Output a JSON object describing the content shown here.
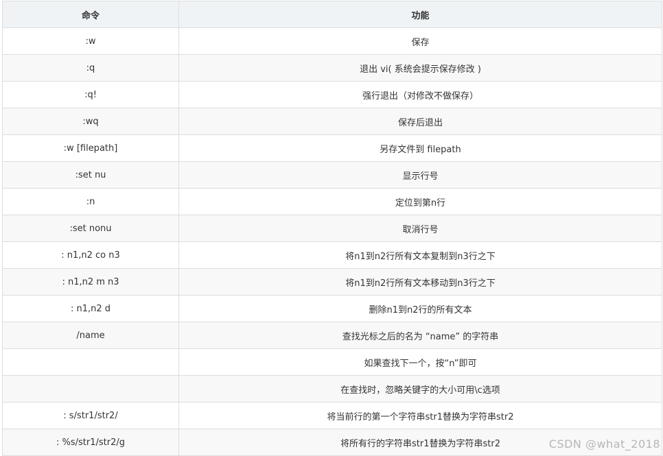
{
  "table": {
    "headers": [
      "命令",
      "功能"
    ],
    "rows": [
      {
        "command": ":w",
        "function": "保存"
      },
      {
        "command": ":q",
        "function": "退出 vi( 系统会提示保存修改 )"
      },
      {
        "command": ":q!",
        "function": "强行退出（对修改不做保存）"
      },
      {
        "command": ":wq",
        "function": "保存后退出"
      },
      {
        "command": ":w [filepath]",
        "function": "另存文件到 filepath"
      },
      {
        "command": ":set nu",
        "function": "显示行号"
      },
      {
        "command": ":n",
        "function": "定位到第n行"
      },
      {
        "command": ":set nonu",
        "function": "取消行号"
      },
      {
        "command": ": n1,n2 co n3",
        "function": "将n1到n2行所有文本复制到n3行之下"
      },
      {
        "command": ": n1,n2 m n3",
        "function": "将n1到n2行所有文本移动到n3行之下"
      },
      {
        "command": ": n1,n2 d",
        "function": "删除n1到n2行的所有文本"
      },
      {
        "command": "/name",
        "function": "查找光标之后的名为 “name” 的字符串"
      },
      {
        "command": "",
        "function": "如果查找下一个，按“n”即可"
      },
      {
        "command": "",
        "function": "在查找时，忽略关键字的大小可用\\c选项"
      },
      {
        "command": ": s/str1/str2/",
        "function": "将当前行的第一个字符串str1替换为字符串str2"
      },
      {
        "command": ": %s/str1/str2/g",
        "function": "将所有行的字符串str1替换为字符串str2"
      }
    ]
  },
  "watermark": "CSDN @what_2018"
}
